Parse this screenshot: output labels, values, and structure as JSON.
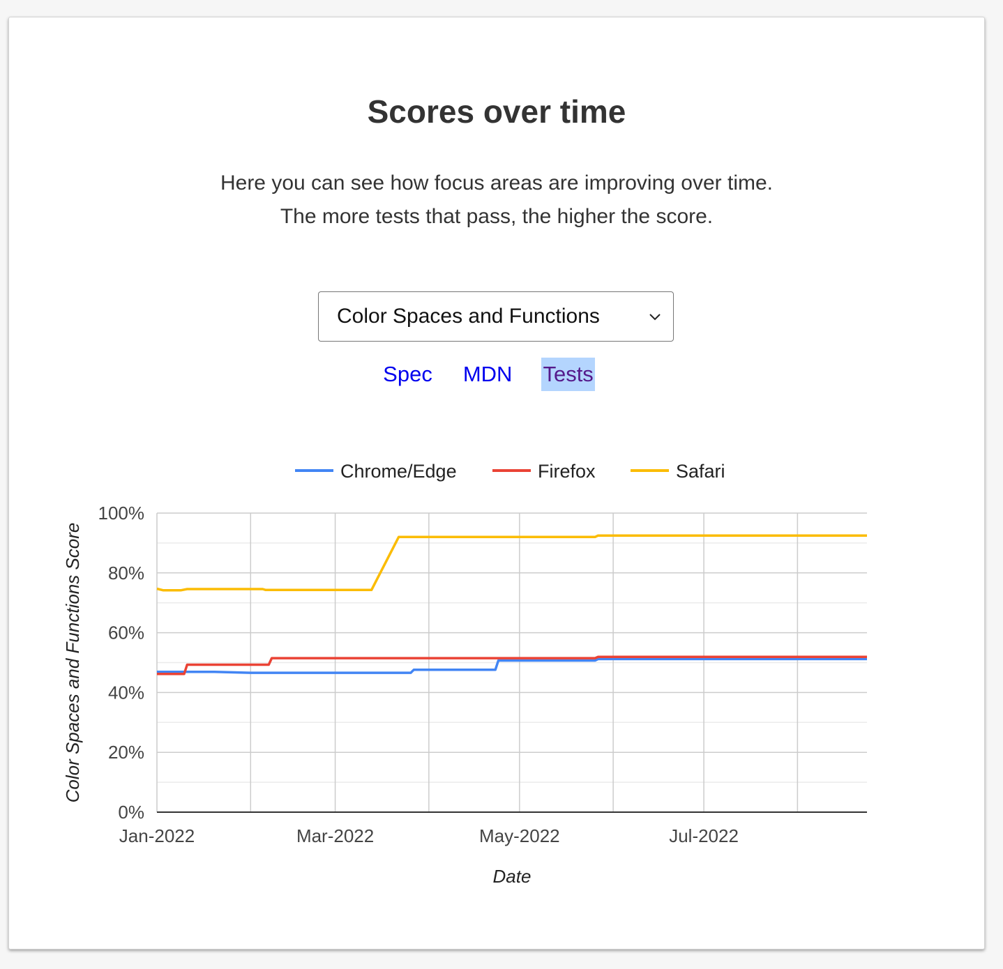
{
  "heading": "Scores over time",
  "description": "Here you can see how focus areas are improving over time. The more tests that pass, the higher the score.",
  "focus_select": {
    "selected": "Color Spaces and Functions"
  },
  "links": {
    "spec": "Spec",
    "mdn": "MDN",
    "tests": "Tests"
  },
  "colors": {
    "chrome": "#4285f4",
    "firefox": "#ea4335",
    "safari": "#fbbc04"
  },
  "chart_data": {
    "type": "line",
    "xlabel": "Date",
    "ylabel": "Color Spaces and Functions Score",
    "ylim": [
      0,
      100
    ],
    "xlim": [
      "2022-01-01",
      "2022-08-24"
    ],
    "x_ticks": [
      {
        "date": "2022-01-01",
        "label": "Jan-2022"
      },
      {
        "date": "2022-03-01",
        "label": "Mar-2022"
      },
      {
        "date": "2022-05-01",
        "label": "May-2022"
      },
      {
        "date": "2022-07-01",
        "label": "Jul-2022"
      }
    ],
    "y_ticks": [
      0,
      20,
      40,
      60,
      80,
      100
    ],
    "y_tick_labels": [
      "0%",
      "20%",
      "40%",
      "60%",
      "80%",
      "100%"
    ],
    "grid": true,
    "legend_position": "top",
    "series": [
      {
        "name": "Chrome/Edge",
        "color_key": "chrome",
        "points": [
          [
            "2022-01-01",
            46.9
          ],
          [
            "2022-01-20",
            46.9
          ],
          [
            "2022-02-01",
            46.6
          ],
          [
            "2022-03-26",
            46.6
          ],
          [
            "2022-03-27",
            47.6
          ],
          [
            "2022-04-23",
            47.6
          ],
          [
            "2022-04-24",
            50.7
          ],
          [
            "2022-05-26",
            50.7
          ],
          [
            "2022-05-27",
            51.2
          ],
          [
            "2022-08-24",
            51.2
          ]
        ]
      },
      {
        "name": "Firefox",
        "color_key": "firefox",
        "points": [
          [
            "2022-01-01",
            46.2
          ],
          [
            "2022-01-10",
            46.2
          ],
          [
            "2022-01-11",
            49.3
          ],
          [
            "2022-02-07",
            49.3
          ],
          [
            "2022-02-08",
            51.5
          ],
          [
            "2022-05-26",
            51.5
          ],
          [
            "2022-05-27",
            51.9
          ],
          [
            "2022-08-24",
            51.9
          ]
        ]
      },
      {
        "name": "Safari",
        "color_key": "safari",
        "points": [
          [
            "2022-01-01",
            74.7
          ],
          [
            "2022-01-03",
            74.2
          ],
          [
            "2022-01-09",
            74.2
          ],
          [
            "2022-01-11",
            74.6
          ],
          [
            "2022-02-05",
            74.6
          ],
          [
            "2022-02-06",
            74.3
          ],
          [
            "2022-03-13",
            74.3
          ],
          [
            "2022-03-22",
            92.0
          ],
          [
            "2022-05-26",
            92.0
          ],
          [
            "2022-05-27",
            92.5
          ],
          [
            "2022-08-24",
            92.5
          ]
        ]
      }
    ]
  }
}
